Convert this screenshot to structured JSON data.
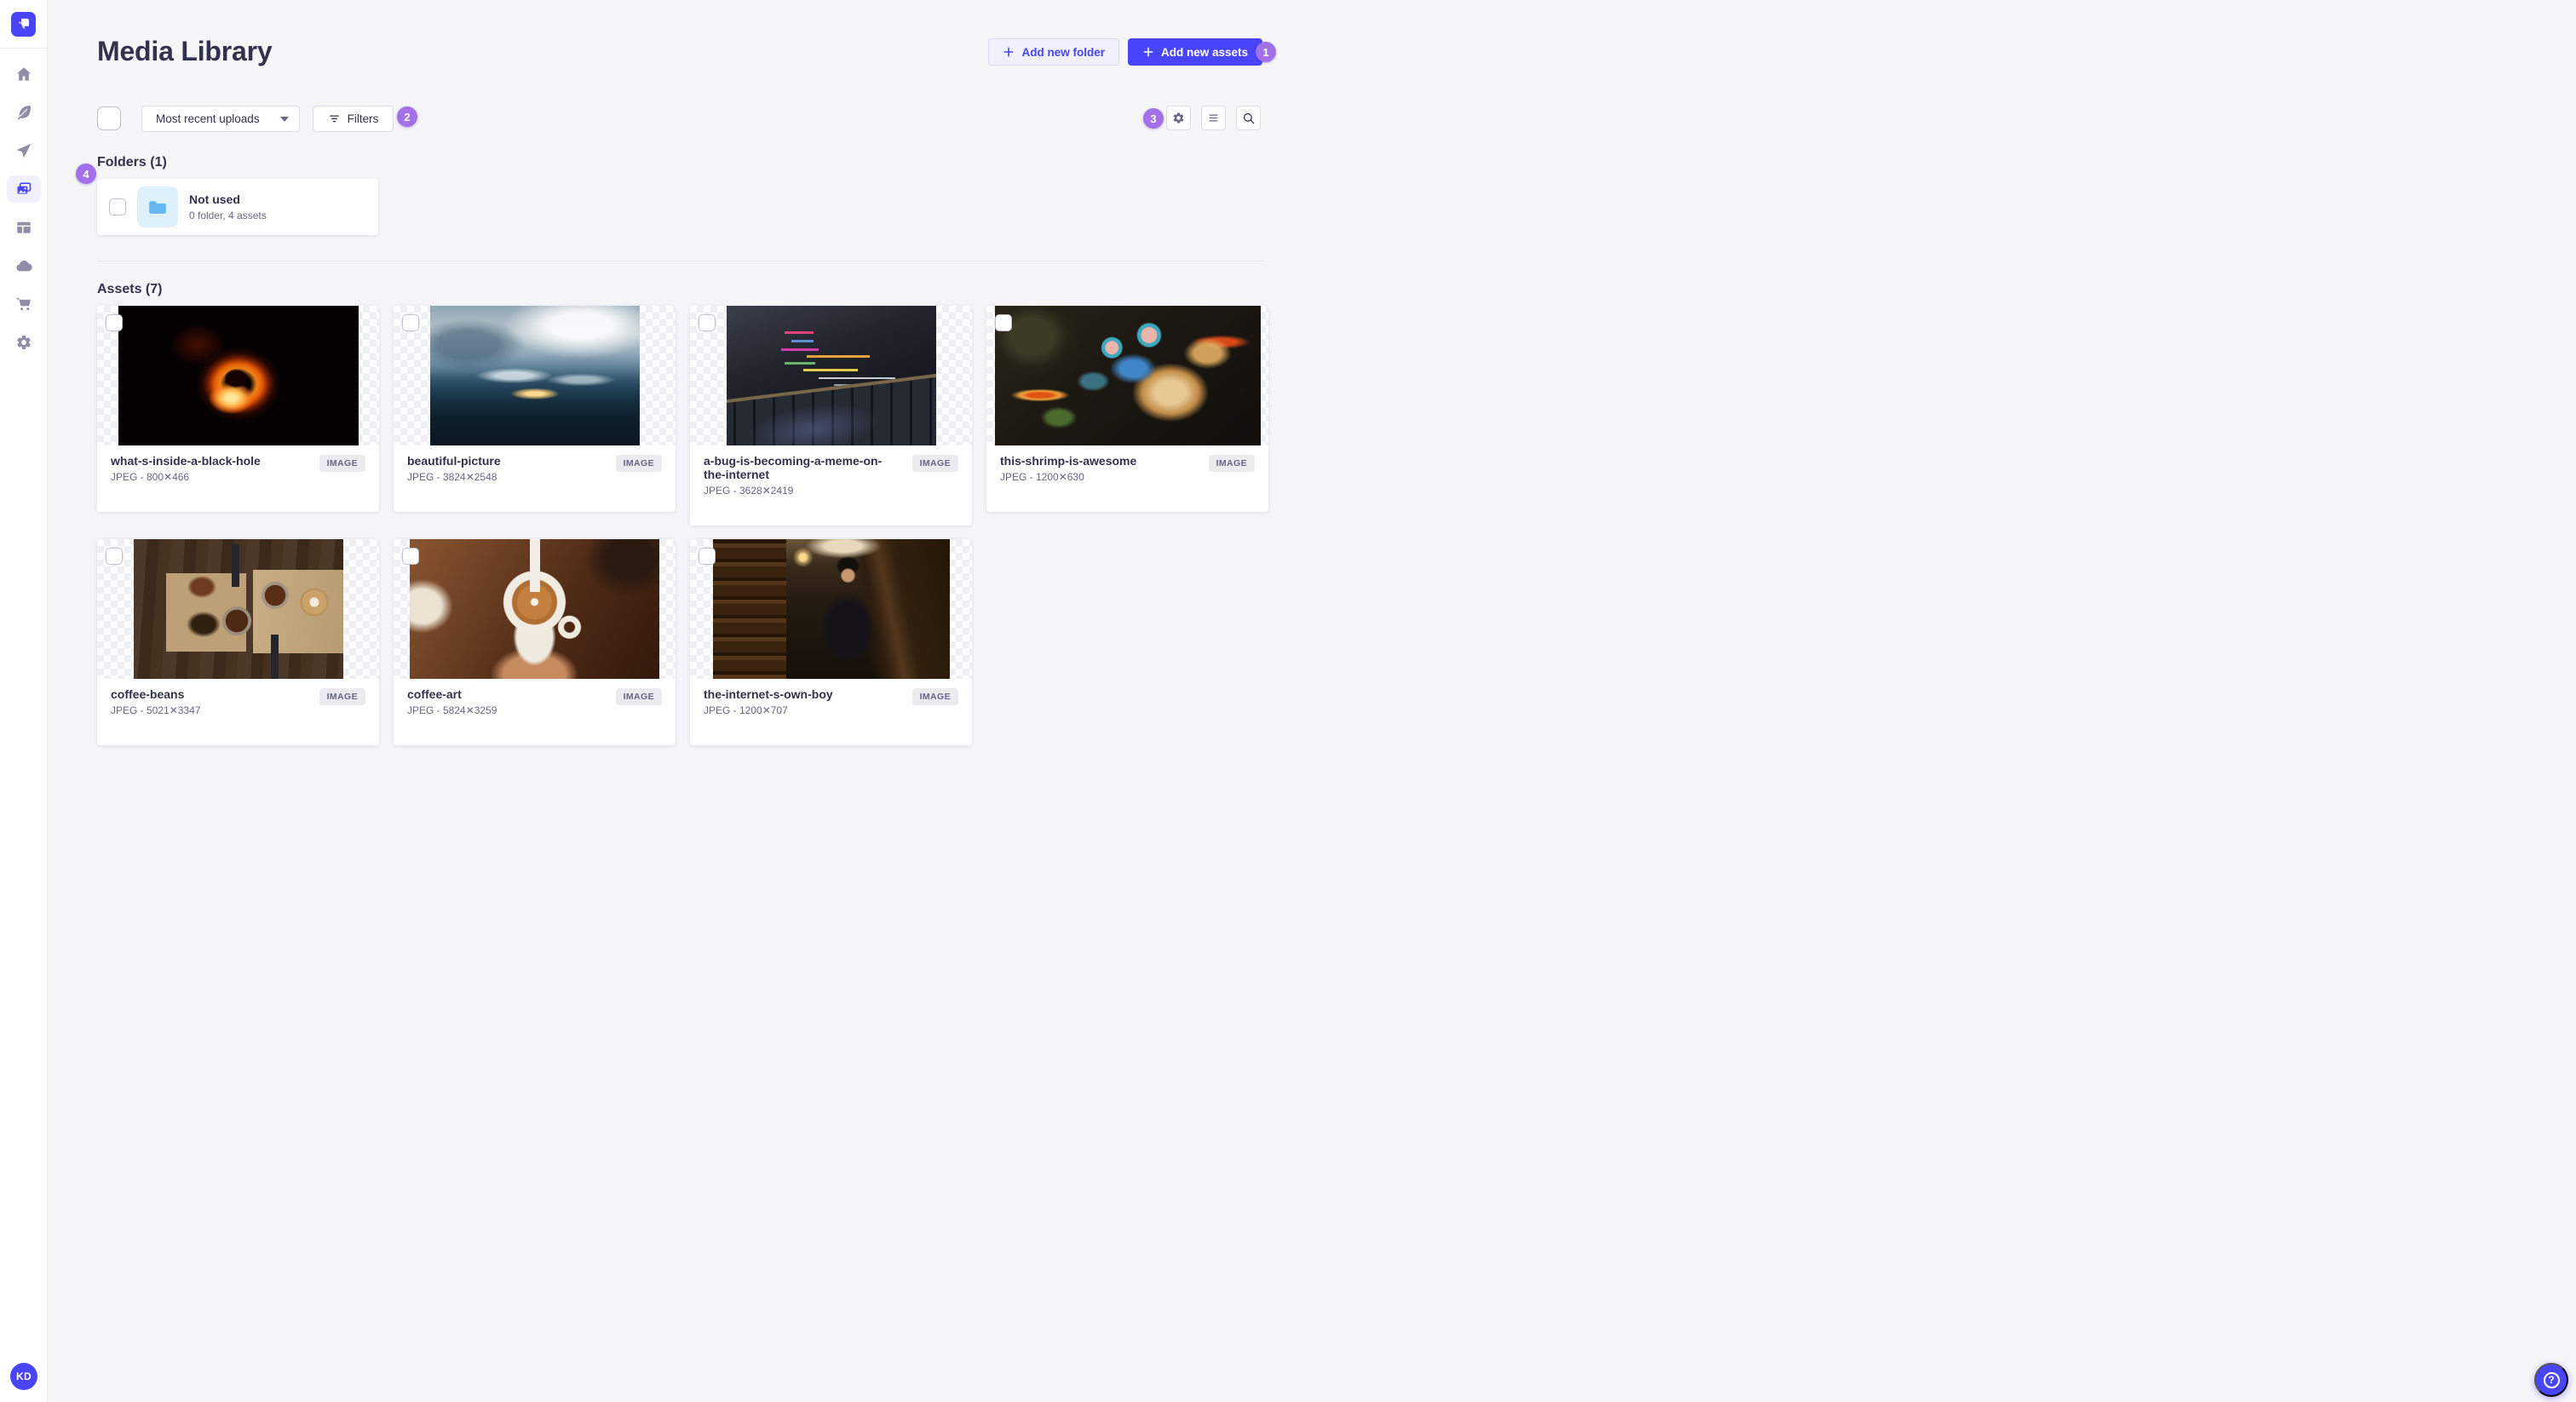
{
  "page": {
    "title": "Media Library"
  },
  "header": {
    "add_new_folder": "Add new folder",
    "add_new_assets": "Add new assets"
  },
  "toolbar": {
    "sort_selected": "Most recent uploads",
    "filters_label": "Filters"
  },
  "annotations": {
    "badge1": "1",
    "badge2": "2",
    "badge3": "3",
    "badge4": "4"
  },
  "folders": {
    "heading": "Folders (1)",
    "items": [
      {
        "title": "Not used",
        "subtitle": "0 folder, 4 assets"
      }
    ]
  },
  "assets": {
    "heading": "Assets (7)",
    "items": [
      {
        "title": "what-s-inside-a-black-hole",
        "meta": "JPEG - 800✕466",
        "badge": "IMAGE",
        "subject": "black-hole-photo"
      },
      {
        "title": "beautiful-picture",
        "meta": "JPEG - 3824✕2548",
        "badge": "IMAGE",
        "subject": "mountain-landscape-photo"
      },
      {
        "title": "a-bug-is-becoming-a-meme-on-the-internet",
        "meta": "JPEG - 3628✕2419",
        "badge": "IMAGE",
        "subject": "laptop-code-photo"
      },
      {
        "title": "this-shrimp-is-awesome",
        "meta": "JPEG - 1200✕630",
        "badge": "IMAGE",
        "subject": "mantis-shrimp-photo"
      },
      {
        "title": "coffee-beans",
        "meta": "JPEG - 5021✕3347",
        "badge": "IMAGE",
        "subject": "coffee-beans-photo"
      },
      {
        "title": "coffee-art",
        "meta": "JPEG - 5824✕3259",
        "badge": "IMAGE",
        "subject": "latte-art-photo"
      },
      {
        "title": "the-internet-s-own-boy",
        "meta": "JPEG - 1200✕707",
        "badge": "IMAGE",
        "subject": "library-portrait-photo"
      }
    ]
  },
  "user": {
    "initials": "KD"
  },
  "sidebar": {
    "icons": [
      "strapi-logo",
      "home",
      "feather",
      "paper-plane",
      "media-library",
      "layout",
      "cloud",
      "cart",
      "settings"
    ]
  },
  "colors": {
    "primary": "#4945ff",
    "annotation_purple": "#a271e8",
    "folder_blue": "#66b7f1",
    "background": "#f6f6f9"
  }
}
